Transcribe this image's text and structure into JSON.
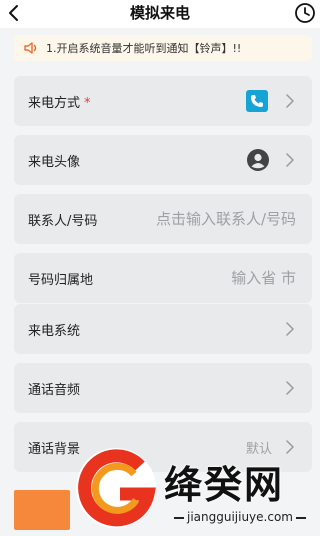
{
  "header": {
    "title": "模拟来电",
    "back_icon": "chevron-left-icon",
    "history_icon": "clock-icon"
  },
  "notice": {
    "icon": "speaker-icon",
    "text": "1.开启系统音量才能听到通知【铃声】!!"
  },
  "rows": [
    {
      "label": "来电方式",
      "required_mark": "*",
      "icon": "phone-icon"
    },
    {
      "label": "来电头像",
      "icon": "avatar-icon"
    },
    {
      "label": "联系人/号码",
      "placeholder": "点击输入联系人/号码"
    },
    {
      "label": "号码归属地",
      "placeholder": "输入省 市"
    },
    {
      "label": "来电系统"
    },
    {
      "label": "通话音频"
    },
    {
      "label": "通话背景",
      "value": "默认"
    }
  ],
  "watermark": {
    "brand": "绛癸网",
    "url": "jiangguijiuye.com"
  },
  "colors": {
    "accent_phone": "#16a3d6",
    "required": "#e53935",
    "notice_bg": "#fdf6ea",
    "bottom_button": "#f5883a"
  }
}
